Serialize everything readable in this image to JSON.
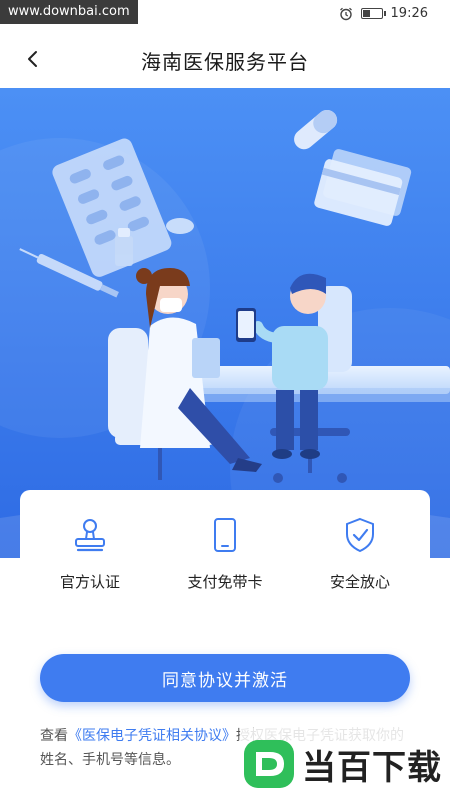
{
  "status_bar": {
    "watermark": "www.downbai.com",
    "time": "19:26",
    "battery_level_percent": 35
  },
  "nav": {
    "title": "海南医保服务平台",
    "back_icon": "chevron-left-icon"
  },
  "features": [
    {
      "label": "官方认证",
      "icon": "stamp-icon"
    },
    {
      "label": "支付免带卡",
      "icon": "phone-icon"
    },
    {
      "label": "安全放心",
      "icon": "shield-check-icon"
    }
  ],
  "activate_button": {
    "label": "同意协议并激活"
  },
  "agreement": {
    "prefix": "查看",
    "link": "《医保电子凭证相关协议》",
    "suffix": "授权医保电子凭证获取你的姓名、手机号等信息。"
  },
  "logo": {
    "text": "当百下载"
  },
  "colors": {
    "accent": "#3f7cf0",
    "hero_top": "#4a8df4",
    "hero_bottom": "#2f6fe6"
  }
}
